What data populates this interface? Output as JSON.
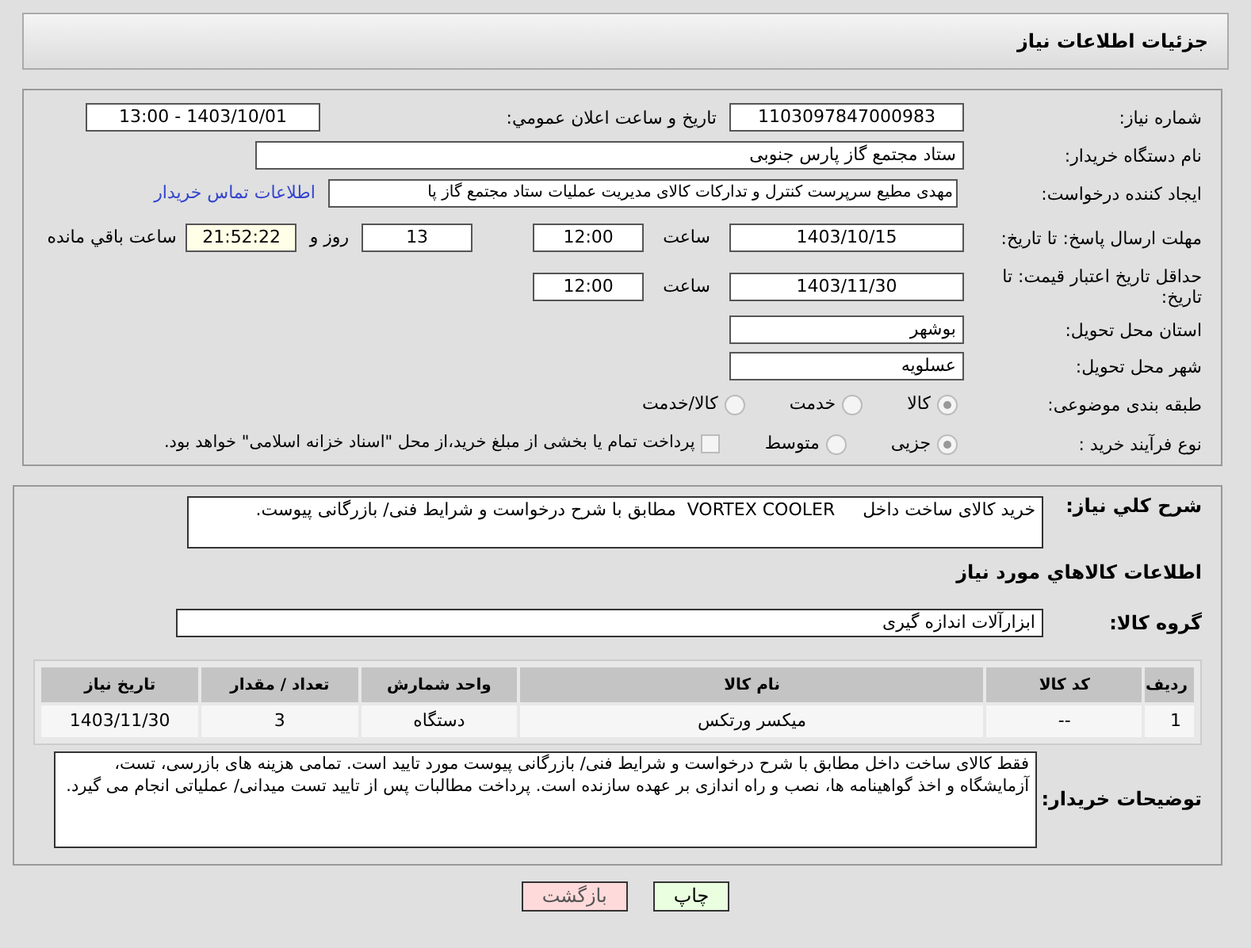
{
  "header": {
    "title": "جزئیات اطلاعات نیاز"
  },
  "need_number": {
    "label": "شماره نیاز:",
    "value": "1103097847000983"
  },
  "announce": {
    "label": "تاریخ و ساعت اعلان عمومي:",
    "value": "1403/10/01 - 13:00"
  },
  "buyer": {
    "label": "نام دستگاه خریدار:",
    "value": "ستاد مجتمع گاز پارس جنوبی"
  },
  "creator": {
    "label": "ایجاد کننده درخواست:",
    "value": "مهدی مطیع سرپرست کنترل و تدارکات کالای مدیریت عملیات ستاد مجتمع گاز پا",
    "link": "اطلاعات تماس خریدار"
  },
  "deadline": {
    "label": "مهلت ارسال پاسخ: تا تاریخ:",
    "date": "1403/10/15",
    "time_label": "ساعت",
    "time": "12:00",
    "days": "13",
    "days_label": "روز و",
    "remaining": "21:52:22",
    "remaining_label": "ساعت باقي مانده"
  },
  "validity": {
    "label": "حداقل تاریخ اعتبار قیمت: تا تاریخ:",
    "date": "1403/11/30",
    "time_label": "ساعت",
    "time": "12:00"
  },
  "province": {
    "label": "استان محل تحویل:",
    "value": "بوشهر"
  },
  "city": {
    "label": "شهر محل تحویل:",
    "value": "عسلویه"
  },
  "category": {
    "label": "طبقه بندی موضوعی:",
    "options": [
      {
        "label": "کالا",
        "selected": true
      },
      {
        "label": "خدمت",
        "selected": false
      },
      {
        "label": "کالا/خدمت",
        "selected": false
      }
    ]
  },
  "process": {
    "label": "نوع فرآیند خرید :",
    "options": [
      {
        "label": "جزیی",
        "selected": true
      },
      {
        "label": "متوسط",
        "selected": false
      }
    ],
    "treasury": {
      "label": "پرداخت تمام یا بخشی از مبلغ خرید،از محل \"اسناد خزانه اسلامی\" خواهد بود.",
      "checked": false
    }
  },
  "summary": {
    "label": "شرح کلي نیاز:",
    "value": "خرید کالای ساخت داخل     VORTEX COOLER  مطابق با شرح درخواست و شرایط فنی/ بازرگانی پیوست."
  },
  "goods_heading": "اطلاعات کالاهاي مورد نیاز",
  "goods_group": {
    "label": "گروه کالا:",
    "value": "ابزارآلات اندازه گیری"
  },
  "table": {
    "columns": [
      "ردیف",
      "کد کالا",
      "نام کالا",
      "واحد شمارش",
      "تعداد / مقدار",
      "تاریخ نیاز"
    ],
    "rows": [
      [
        "1",
        "--",
        "میکسر ورتکس",
        "دستگاه",
        "3",
        "1403/11/30"
      ]
    ]
  },
  "notes": {
    "label": "توضیحات خریدار:",
    "value": "فقط کالای ساخت داخل مطابق با شرح درخواست و شرایط فنی/ بازرگانی پیوست مورد تایید است. تمامی هزینه های بازرسی، تست، آزمایشگاه و اخذ گواهینامه ها، نصب و راه اندازی بر عهده سازنده است. پرداخت مطالبات پس از تایید تست میدانی/ عملیاتی انجام می گیرد."
  },
  "buttons": [
    {
      "label": "چاپ",
      "kind": "print"
    },
    {
      "label": "بازگشت",
      "kind": "back"
    }
  ]
}
